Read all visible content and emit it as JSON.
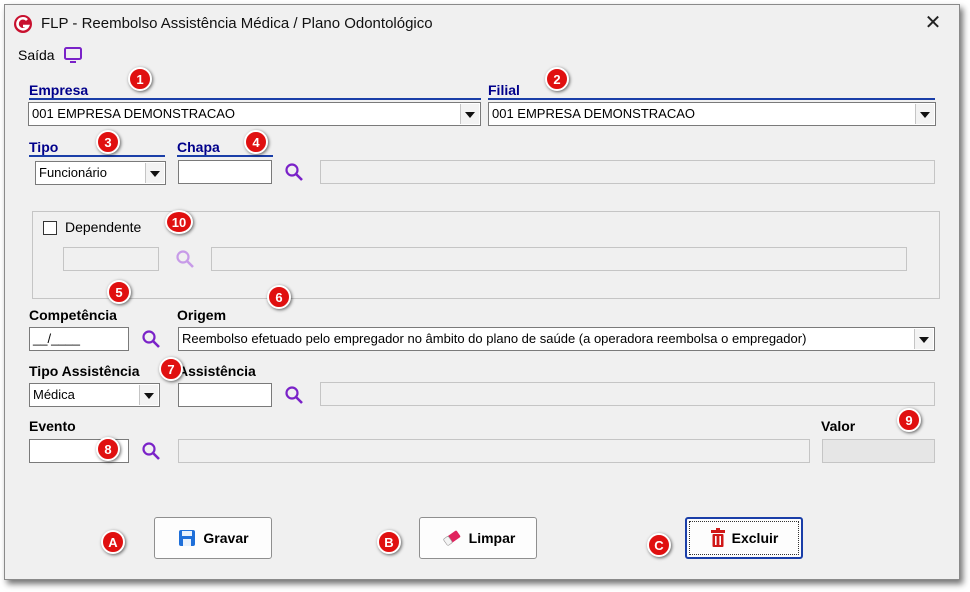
{
  "window": {
    "title": "FLP - Reembolso Assistência Médica / Plano Odontológico",
    "close_glyph": "✕"
  },
  "menu": {
    "saida_label": "Saída"
  },
  "colors": {
    "label_blue": "#00008b",
    "badge_red": "#e01010",
    "icon_purple": "#7a22c8",
    "focus_blue": "#1a3ea8"
  },
  "form": {
    "empresa": {
      "label": "Empresa",
      "value": "001 EMPRESA DEMONSTRACAO"
    },
    "filial": {
      "label": "Filial",
      "value": "001 EMPRESA DEMONSTRACAO"
    },
    "tipo": {
      "label": "Tipo",
      "value": "Funcionário"
    },
    "chapa": {
      "label": "Chapa",
      "value": "",
      "description": ""
    },
    "dependente": {
      "label": "Dependente",
      "checked": false,
      "value": "",
      "description": ""
    },
    "competencia": {
      "label": "Competência",
      "value": "__/____"
    },
    "origem": {
      "label": "Origem",
      "value": "Reembolso efetuado pelo empregador no âmbito do plano de saúde (a operadora reembolsa o empregador)"
    },
    "tipo_assistencia": {
      "label": "Tipo Assistência",
      "value": "Médica"
    },
    "assistencia": {
      "label": "Assistência",
      "value": "",
      "description": ""
    },
    "evento": {
      "label": "Evento",
      "value": "",
      "description": ""
    },
    "valor": {
      "label": "Valor",
      "value": ""
    }
  },
  "badges": {
    "b1": "1",
    "b2": "2",
    "b3": "3",
    "b4": "4",
    "b5": "5",
    "b6": "6",
    "b7": "7",
    "b8": "8",
    "b9": "9",
    "b10": "10",
    "bA": "A",
    "bB": "B",
    "bC": "C"
  },
  "buttons": {
    "gravar": "Gravar",
    "limpar": "Limpar",
    "excluir": "Excluir"
  },
  "icons": {
    "app": "app-logo-icon",
    "saida": "monitor-icon",
    "search": "search-icon",
    "save": "floppy-icon",
    "clear": "eraser-icon",
    "delete": "trash-icon"
  }
}
